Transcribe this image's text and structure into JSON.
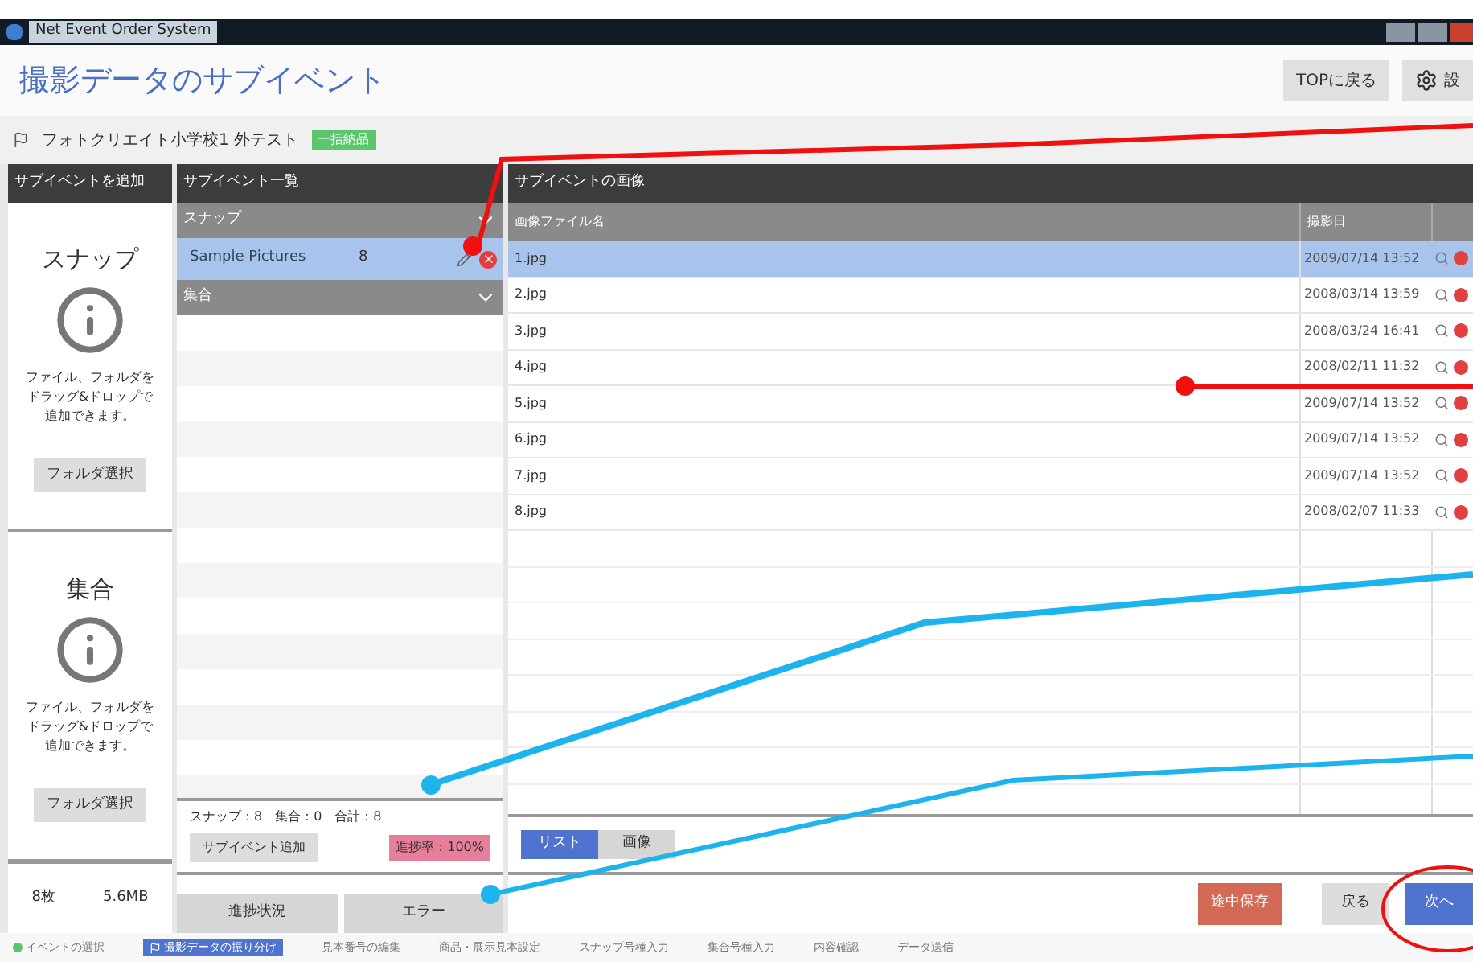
{
  "window": {
    "title": "Net Event Order System"
  },
  "header": {
    "title": "撮影データのサブイベント",
    "buttons": [
      {
        "label": "TOPに戻る",
        "kind": "plain"
      },
      {
        "label": "設",
        "kind": "settings"
      }
    ]
  },
  "breadcrumb": {
    "text": "フォトクリエイト小学校1 外テスト",
    "badge": "一括納品"
  },
  "add_panel": {
    "title": "サブイベントを追加",
    "cards": [
      {
        "title": "スナップ",
        "hint": "ファイル、フォルダをドラッグ&ドロップで追加できます。",
        "button": "フォルダ選択"
      },
      {
        "title": "集合",
        "hint": "ファイル、フォルダをドラッグ&ドロップで追加できます。",
        "button": "フォルダ選択"
      }
    ],
    "count": "8枚",
    "size": "5.6MB"
  },
  "subevents": {
    "title": "サブイベント一覧",
    "groups": [
      {
        "name": "スナップ",
        "expanded": true,
        "items": [
          {
            "name": "Sample Pictures",
            "count": "8",
            "selected": true
          }
        ]
      },
      {
        "name": "集合",
        "expanded": true
      }
    ],
    "summary": "スナップ：8　集合：0　合計：8",
    "add_button": "サブイベント追加",
    "progress": "進捗率：100%",
    "tabs": [
      {
        "label": "進捗状況"
      },
      {
        "label": "エラー"
      }
    ]
  },
  "images": {
    "title": "サブイベントの画像",
    "columns": [
      "画像ファイル名",
      "撮影日"
    ],
    "rows": [
      {
        "name": "1.jpg",
        "date": "2009/07/14 13:52",
        "selected": true
      },
      {
        "name": "2.jpg",
        "date": "2008/03/14 13:59",
        "selected": false
      },
      {
        "name": "3.jpg",
        "date": "2008/03/24 16:41",
        "selected": false
      },
      {
        "name": "4.jpg",
        "date": "2008/02/11 11:32",
        "selected": false
      },
      {
        "name": "5.jpg",
        "date": "2009/07/14 13:52",
        "selected": false
      },
      {
        "name": "6.jpg",
        "date": "2009/07/14 13:52",
        "selected": false
      },
      {
        "name": "7.jpg",
        "date": "2009/07/14 13:52",
        "selected": false
      },
      {
        "name": "8.jpg",
        "date": "2008/02/07 11:33",
        "selected": false
      }
    ],
    "views": [
      {
        "label": "リスト",
        "selected": true
      },
      {
        "label": "画像",
        "selected": false
      }
    ]
  },
  "actions": [
    {
      "label": "途中保存",
      "kind": "save"
    },
    {
      "label": "戻る",
      "kind": "plain"
    },
    {
      "label": "次へ",
      "kind": "primary"
    }
  ],
  "steps": [
    {
      "label": "イベントの選択",
      "kind": "done",
      "selected": false
    },
    {
      "label": "撮影データの振り分け",
      "kind": "current",
      "selected": true
    },
    {
      "label": "見本番号の編集",
      "kind": "todo",
      "selected": false
    },
    {
      "label": "商品・展示見本設定",
      "kind": "todo",
      "selected": false
    },
    {
      "label": "スナップ号種入力",
      "kind": "todo",
      "selected": false
    },
    {
      "label": "集合号種入力",
      "kind": "todo",
      "selected": false
    },
    {
      "label": "内容確認",
      "kind": "todo",
      "selected": false
    },
    {
      "label": "データ送信",
      "kind": "todo",
      "selected": false
    }
  ]
}
